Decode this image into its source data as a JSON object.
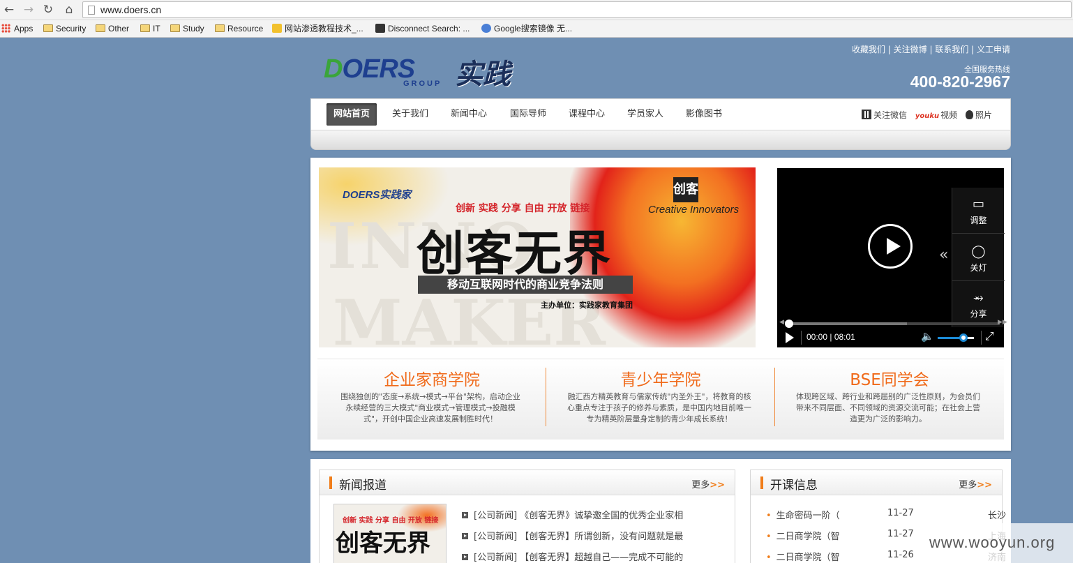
{
  "browser": {
    "url": "www.doers.cn",
    "bookmarks": [
      {
        "label": "Apps",
        "icon": "apps-grid-icon"
      },
      {
        "label": "Security",
        "icon": "folder-icon"
      },
      {
        "label": "Other",
        "icon": "folder-icon"
      },
      {
        "label": "IT",
        "icon": "folder-icon"
      },
      {
        "label": "Study",
        "icon": "folder-icon"
      },
      {
        "label": "Resource",
        "icon": "folder-icon"
      },
      {
        "label": "网站渗透教程技术_...",
        "icon": "site-favicon"
      },
      {
        "label": "Disconnect Search: ...",
        "icon": "disconnect-icon"
      },
      {
        "label": "Google搜索镜像 无...",
        "icon": "google-mirror-icon"
      }
    ]
  },
  "header": {
    "logo_text": "DOERS",
    "logo_group": "GROUP",
    "logo_cn": "实践家",
    "top_links": "收藏我们 | 关注微博 | 联系我们 | 义工申请",
    "hotline_label": "全国服务热线",
    "hotline": "400-820-2967"
  },
  "nav": {
    "items": [
      "网站首页",
      "关于我们",
      "新闻中心",
      "国际导师",
      "课程中心",
      "学员家人",
      "影像图书"
    ],
    "social": {
      "wechat": "关注微信",
      "youku_logo": "youku",
      "video": "视频",
      "photo": "照片"
    }
  },
  "banner": {
    "mini_logo": "DOERS实践家",
    "tagline": "创新 实践 分享 自由 开放 链接",
    "title": "创客无界",
    "subtitle": "移动互联网时代的商业竞争法则",
    "host": "主办单位：实践家教育集团",
    "ck_logo": "创客",
    "ck_en": "Creative Innovators"
  },
  "player": {
    "side": {
      "adjust": "调整",
      "light_off": "关灯",
      "share": "分享"
    },
    "time": "00:00 | 08:01",
    "progress": 0.0,
    "volume": 0.72
  },
  "colleges": [
    {
      "title": "企业家商学院",
      "desc": "围绕独创的\"态度→系统→模式→平台\"架构，启动企业永续经营的三大模式\"商业模式→管理模式→投融模式\"，开创中国企业高速发展制胜时代！"
    },
    {
      "title": "青少年学院",
      "desc": "融汇西方精英教育与儒家传统\"内圣外王\"，将教育的核心重点专注于孩子的修养与素质，是中国内地目前唯一专为精英阶层量身定制的青少年成长系统！"
    },
    {
      "title": "BSE同学会",
      "desc": "体现跨区域、跨行业和跨届别的广泛性原则，为会员们带来不同层面、不同领域的资源交流可能；在社会上营造更为广泛的影响力。"
    }
  ],
  "news": {
    "title": "新闻报道",
    "more": "更多",
    "thumb_tagline": "创新 实践 分享 自由 开放 链接",
    "thumb_title": "创客无界",
    "items": [
      "[公司新闻] 《创客无界》诚挚邀全国的优秀企业家相",
      "[公司新闻] 【创客无界】所谓创新，没有问题就是最",
      "[公司新闻] 【创客无界】超越自己——完成不可能的"
    ]
  },
  "courses": {
    "title": "开课信息",
    "more": "更多",
    "items": [
      {
        "name": "生命密码一阶（",
        "date": "11-27",
        "city": "长沙"
      },
      {
        "name": "二日商学院（智",
        "date": "11-27",
        "city": "上海"
      },
      {
        "name": "二日商学院（智",
        "date": "11-26",
        "city": "济南"
      }
    ]
  },
  "watermark": "www.wooyun.org"
}
